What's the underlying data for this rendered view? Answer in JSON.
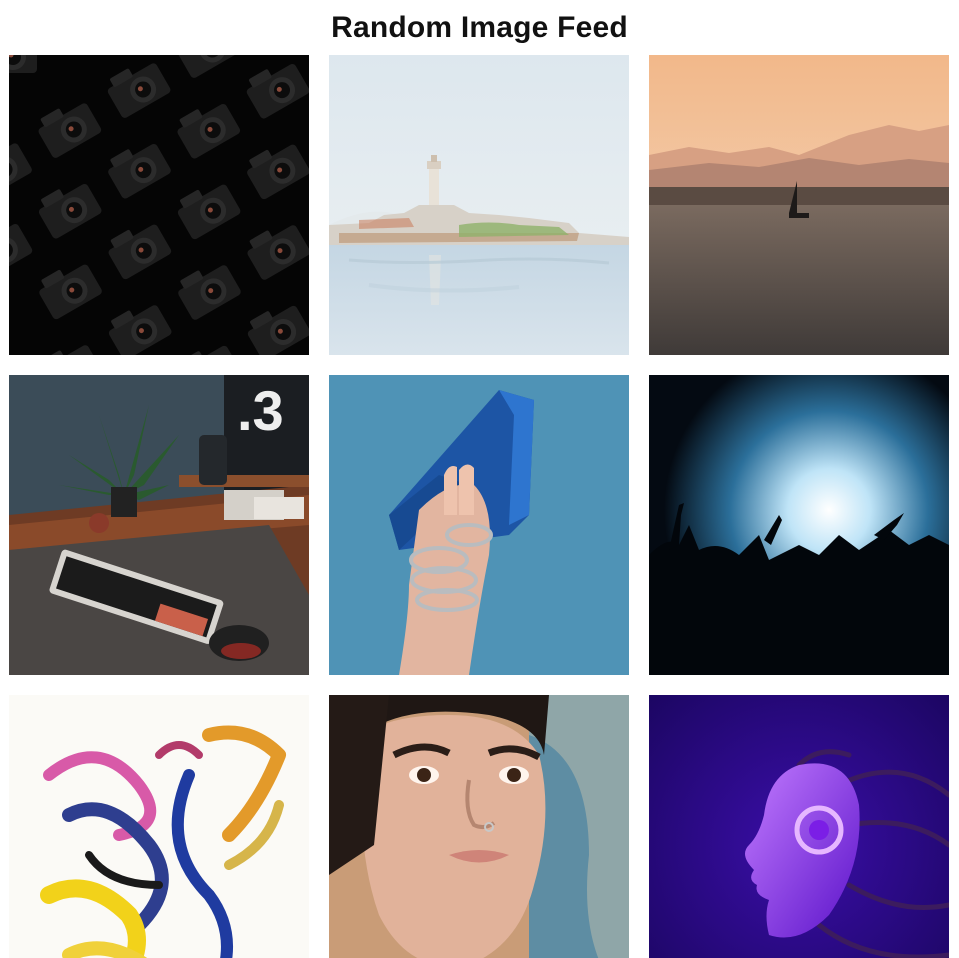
{
  "page": {
    "title": "Random Image Feed"
  },
  "feed": {
    "images": [
      {
        "subject": "cameras-pattern"
      },
      {
        "subject": "watercolor-lighthouse"
      },
      {
        "subject": "sunset-sailboat"
      },
      {
        "subject": "desk-setup"
      },
      {
        "subject": "hand-blue-bag"
      },
      {
        "subject": "concert-crowd"
      },
      {
        "subject": "abstract-paint"
      },
      {
        "subject": "woman-portrait"
      },
      {
        "subject": "purple-head"
      }
    ]
  }
}
